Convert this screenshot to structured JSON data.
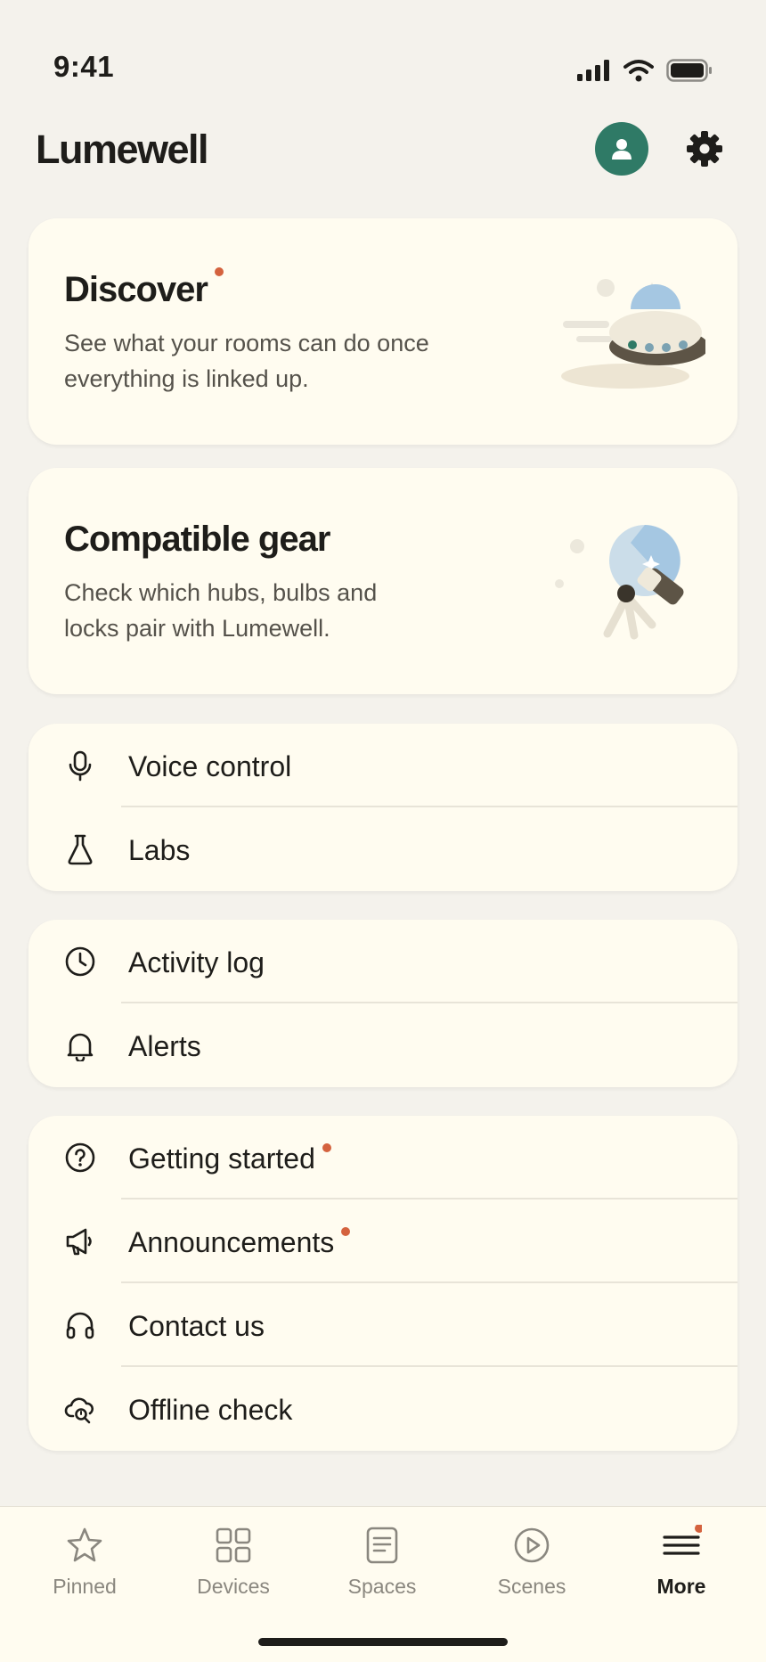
{
  "status_bar": {
    "time": "9:41"
  },
  "header": {
    "title": "Lumewell"
  },
  "feature_cards": [
    {
      "title": "Discover",
      "description": "See what your rooms can do once everything is linked up.",
      "has_new": true
    },
    {
      "title": "Compatible gear",
      "description": "Check which hubs, bulbs and locks pair with Lumewell.",
      "has_new": false
    }
  ],
  "groups": [
    {
      "items": [
        {
          "label": "Voice control",
          "icon": "microphone-icon"
        },
        {
          "label": "Labs",
          "icon": "flask-icon"
        }
      ]
    },
    {
      "items": [
        {
          "label": "Activity log",
          "icon": "clock-icon"
        },
        {
          "label": "Alerts",
          "icon": "bell-icon"
        }
      ]
    },
    {
      "items": [
        {
          "label": "Getting started",
          "icon": "help-icon",
          "has_new": true
        },
        {
          "label": "Announcements",
          "icon": "megaphone-icon",
          "has_new": true
        },
        {
          "label": "Contact us",
          "icon": "headphones-icon"
        },
        {
          "label": "Offline check",
          "icon": "cloud-search-icon"
        }
      ]
    }
  ],
  "tabs": [
    {
      "label": "Pinned",
      "icon": "star-icon"
    },
    {
      "label": "Devices",
      "icon": "grid-icon"
    },
    {
      "label": "Spaces",
      "icon": "document-icon"
    },
    {
      "label": "Scenes",
      "icon": "play-icon"
    },
    {
      "label": "More",
      "icon": "menu-icon",
      "active": true,
      "has_new": true
    }
  ],
  "colors": {
    "accent": "#2f7a66",
    "badge": "#d4623e",
    "background": "#f4f2ec",
    "card": "#fffcf0"
  }
}
